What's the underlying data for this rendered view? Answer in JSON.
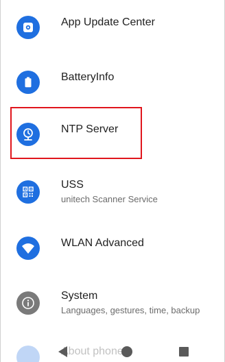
{
  "settings": {
    "items": [
      {
        "title": "App Update Center",
        "subtitle": "",
        "icon": "gear-icon",
        "color": "#1f6fe0"
      },
      {
        "title": "BatteryInfo",
        "subtitle": "",
        "icon": "battery-icon",
        "color": "#1f6fe0"
      },
      {
        "title": "NTP Server",
        "subtitle": "",
        "icon": "clock-pin-icon",
        "color": "#1f6fe0"
      },
      {
        "title": "USS",
        "subtitle": "unitech Scanner Service",
        "icon": "qr-code-icon",
        "color": "#1f6fe0"
      },
      {
        "title": "WLAN Advanced",
        "subtitle": "",
        "icon": "wifi-icon",
        "color": "#1f6fe0"
      },
      {
        "title": "System",
        "subtitle": "Languages, gestures, time, backup",
        "icon": "info-icon",
        "color": "#7a7a7a"
      }
    ],
    "faded_item": {
      "title": "About phone",
      "icon": "phone-icon",
      "color": "#1f6fe0"
    }
  },
  "navigation": {
    "back": "back-icon",
    "home": "home-icon",
    "recents": "recents-icon"
  },
  "highlight_color": "#e0151c"
}
